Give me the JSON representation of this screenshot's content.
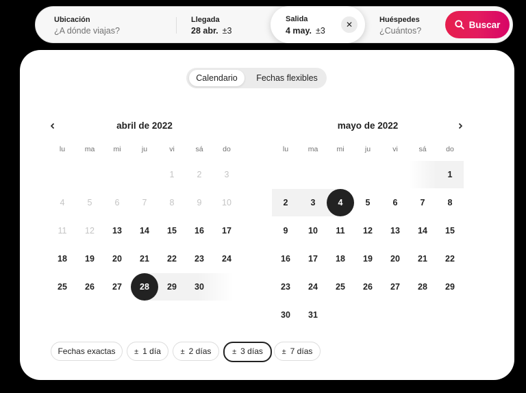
{
  "search": {
    "location_label": "Ubicación",
    "location_placeholder": "¿A dónde viajas?",
    "checkin_label": "Llegada",
    "checkin_value": "28 abr.",
    "checkin_flex": "±3",
    "checkout_label": "Salida",
    "checkout_value": "4 may.",
    "checkout_flex": "±3",
    "clear_icon": "✕",
    "guests_label": "Huéspedes",
    "guests_placeholder": "¿Cuántos?",
    "search_button": "Buscar"
  },
  "tabs": {
    "calendar": "Calendario",
    "flexible": "Fechas flexibles"
  },
  "calendar": {
    "weekdays": [
      "lu",
      "ma",
      "mi",
      "ju",
      "vi",
      "sá",
      "do"
    ],
    "months": [
      {
        "title": "abril de 2022",
        "weeks": [
          [
            "",
            "",
            "",
            "",
            "1",
            "2",
            "3"
          ],
          [
            "4",
            "5",
            "6",
            "7",
            "8",
            "9",
            "10"
          ],
          [
            "11",
            "12",
            "13",
            "14",
            "15",
            "16",
            "17"
          ],
          [
            "18",
            "19",
            "20",
            "21",
            "22",
            "23",
            "24"
          ],
          [
            "25",
            "26",
            "27",
            "28",
            "29",
            "30",
            ""
          ]
        ],
        "disabled_through": 12,
        "selected": 28
      },
      {
        "title": "mayo de 2022",
        "weeks": [
          [
            "",
            "",
            "",
            "",
            "",
            "",
            "1"
          ],
          [
            "2",
            "3",
            "4",
            "5",
            "6",
            "7",
            "8"
          ],
          [
            "9",
            "10",
            "11",
            "12",
            "13",
            "14",
            "15"
          ],
          [
            "16",
            "17",
            "18",
            "19",
            "20",
            "21",
            "22"
          ],
          [
            "23",
            "24",
            "25",
            "26",
            "27",
            "28",
            "29"
          ],
          [
            "30",
            "31",
            "",
            "",
            "",
            "",
            ""
          ]
        ],
        "disabled_through": 0,
        "selected": 4
      }
    ]
  },
  "chips": [
    {
      "label": "Fechas exactas",
      "pm": ""
    },
    {
      "label": "1 día",
      "pm": "±"
    },
    {
      "label": "2 días",
      "pm": "±"
    },
    {
      "label": "3 días",
      "pm": "±",
      "active": true
    },
    {
      "label": "7 días",
      "pm": "±"
    }
  ],
  "colors": {
    "accent": "#e61e4d",
    "selected": "#222222",
    "range": "#f2f2f2"
  }
}
